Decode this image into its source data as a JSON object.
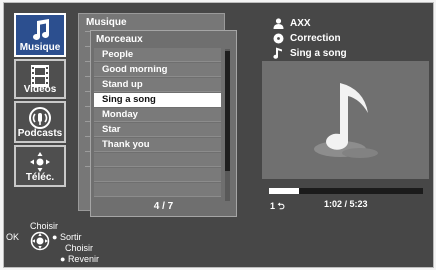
{
  "nav": {
    "items": [
      {
        "label": "Musique",
        "icon": "music-note-icon",
        "active": true
      },
      {
        "label": "Vidéos",
        "icon": "film-strip-icon",
        "active": false
      },
      {
        "label": "Podcasts",
        "icon": "podcast-icon",
        "active": false
      },
      {
        "label": "Téléc.",
        "icon": "remote-dpad-icon",
        "active": false
      }
    ]
  },
  "panel_back": {
    "title": "Musique"
  },
  "list": {
    "title": "Morceaux",
    "items": [
      "People",
      "Good morning",
      "Stand up",
      "Sing a song",
      "Monday",
      "Star",
      "Thank you"
    ],
    "selected_index": 3,
    "page_indicator": "4 / 7"
  },
  "now_playing": {
    "artist": "AXX",
    "album": "Correction",
    "track": "Sing a song",
    "progress_fraction": 0.197,
    "elapsed": "1:02",
    "total": "5:23",
    "time_label": "1:02 / 5:23",
    "repeat_label": "1"
  },
  "hints": {
    "ok": "OK",
    "choose_top": "Choisir",
    "exit": "Sortir",
    "choose": "Choisir",
    "back": "Revenir"
  },
  "colors": {
    "accent": "#2c4f8f",
    "selected_row": "#ffffff",
    "screen_bg": "#474747"
  }
}
